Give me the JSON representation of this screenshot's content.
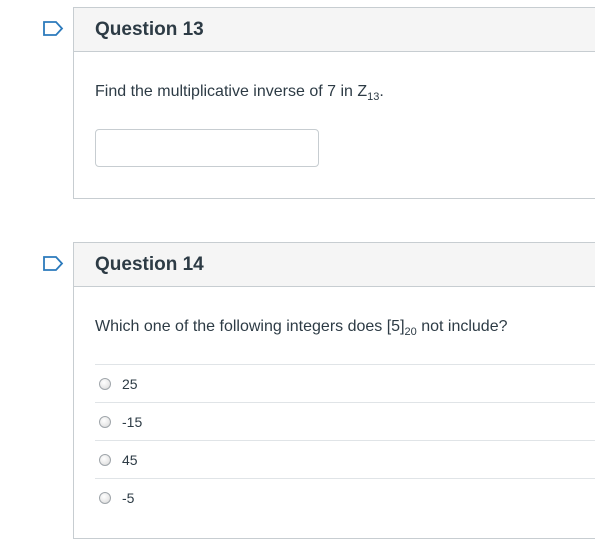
{
  "questions": [
    {
      "title": "Question 13",
      "text_main": "Find the multiplicative inverse of 7 in Z",
      "text_sub": "13",
      "text_after": ".",
      "input_value": ""
    },
    {
      "title": "Question 14",
      "text_main": "Which one of the following integers does [5]",
      "text_sub": "20",
      "text_after": " not include?",
      "options": [
        "25",
        "-15",
        "45",
        "-5"
      ]
    }
  ],
  "colors": {
    "flag_stroke": "#2b7abc",
    "header_bg": "#f5f5f5",
    "border": "#c7cdd1"
  },
  "icons": {
    "flag": "flag-icon",
    "radio": "radio-button"
  }
}
